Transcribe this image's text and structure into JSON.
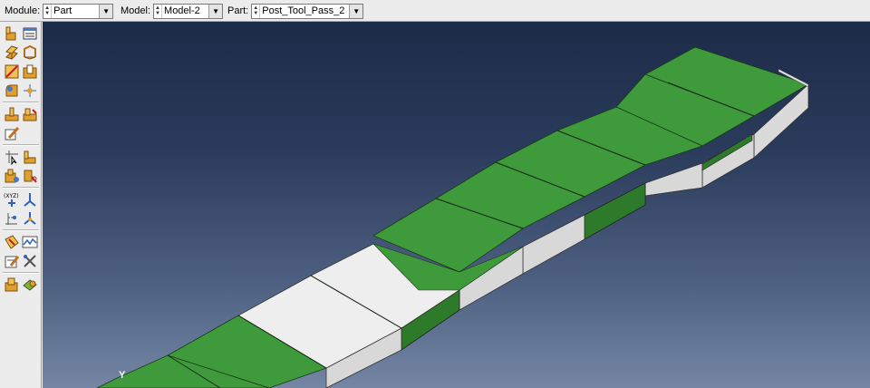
{
  "context_bar": {
    "module": {
      "label": "Module:",
      "value": "Part"
    },
    "model": {
      "label": "Model:",
      "value": "Model-2"
    },
    "part": {
      "label": "Part:",
      "value": "Post_Tool_Pass_2"
    }
  },
  "toolbox": {
    "tools": [
      "create-part-icon",
      "part-manager-icon",
      "create-solid-extrude-icon",
      "create-shell-icon",
      "create-wire-icon",
      "create-cut-icon",
      "create-round-icon",
      "create-datum-icon",
      "partition-face-icon",
      "partition-cell-icon",
      "edit-feature-icon",
      "query-icon",
      "create-reference-point-icon",
      "create-datum-plane-icon",
      "create-datum-axis-icon",
      "datum-point-xyz-icon",
      "datum-csys-icon",
      "datum-point-offset-icon",
      "datum-axis-csys-icon",
      "repair-tool-icon",
      "sketch-icon",
      "feature-manager-icon",
      "geometry-edit-icon",
      "assembly-icon",
      "mesh-part-icon"
    ]
  },
  "viewport": {
    "triad_label": "Y",
    "colors": {
      "green_face": "#3f9a3c",
      "dark_green": "#2e7a2c",
      "gray_face": "#dcdcdc",
      "white_face": "#f0f0f0"
    }
  }
}
